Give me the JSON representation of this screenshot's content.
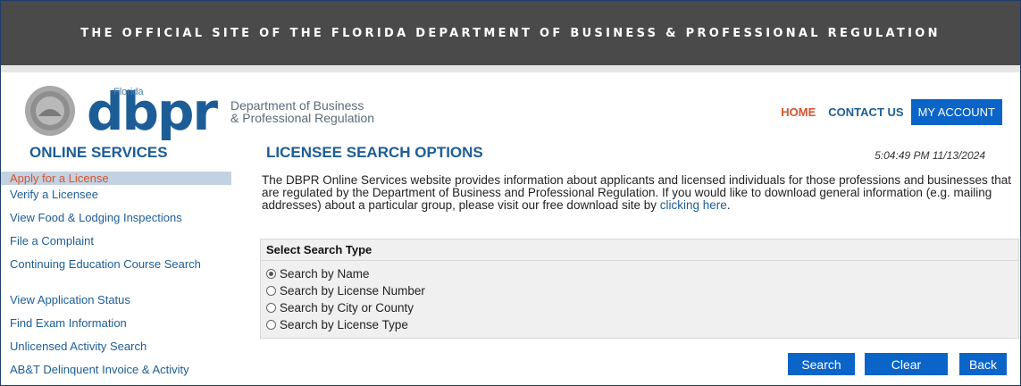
{
  "banner": {
    "text": "THE OFFICIAL SITE OF THE FLORIDA DEPARTMENT OF BUSINESS & PROFESSIONAL REGULATION"
  },
  "logo": {
    "state": "Florida",
    "mark": "dbpr",
    "dept_line1": "Department of Business",
    "dept_line2": "& Professional Regulation"
  },
  "nav": {
    "home": "HOME",
    "contact": "CONTACT US",
    "account": "MY ACCOUNT"
  },
  "sidebar": {
    "title": "ONLINE SERVICES",
    "items": [
      {
        "label": "Apply for a License"
      },
      {
        "label": "Verify a Licensee"
      },
      {
        "label": "View Food & Lodging Inspections"
      },
      {
        "label": "File a Complaint"
      },
      {
        "label": "Continuing Education Course Search"
      },
      {
        "label": "View Application Status"
      },
      {
        "label": "Find Exam Information"
      },
      {
        "label": "Unlicensed Activity Search"
      },
      {
        "label": "AB&T Delinquent Invoice & Activity"
      }
    ]
  },
  "main": {
    "title": "LICENSEE SEARCH OPTIONS",
    "timestamp": "5:04:49 PM 11/13/2024",
    "intro": "The DBPR Online Services website provides information about applicants and licensed individuals for those professions and businesses that are regulated by the Department of Business and Professional Regulation. If you would like to download general information (e.g. mailing addresses) about a particular group, please visit our free download site by ",
    "intro_link": "clicking here",
    "intro_end": "."
  },
  "search": {
    "heading": "Select Search Type",
    "options": [
      {
        "label": "Search by Name",
        "checked": true
      },
      {
        "label": "Search by License Number",
        "checked": false
      },
      {
        "label": "Search by City or County",
        "checked": false
      },
      {
        "label": "Search by License Type",
        "checked": false
      }
    ]
  },
  "buttons": {
    "search": "Search",
    "clear": "Clear",
    "back": "Back"
  },
  "colors": {
    "banner": "#4a4a4a",
    "brand_blue": "#1d5d97",
    "button_blue": "#0b64c8",
    "accent_orange": "#d9532c"
  }
}
